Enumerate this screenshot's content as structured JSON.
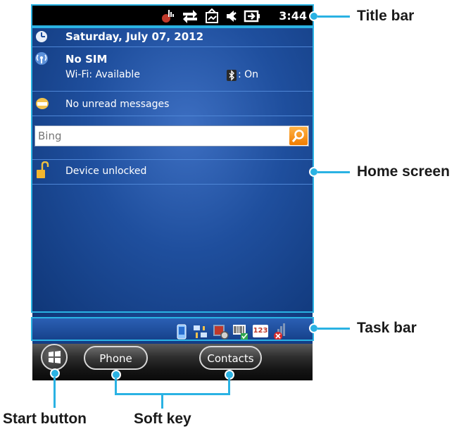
{
  "titlebar": {
    "clock": "3:44"
  },
  "home": {
    "date": "Saturday, July 07, 2012",
    "carrier": "No SIM",
    "wifi": "Wi-Fi: Available",
    "bluetooth": ": On",
    "messages": "No unread messages",
    "search_placeholder": "Bing",
    "lock_status": "Device unlocked"
  },
  "taskbar": {
    "badge_123": "123"
  },
  "softkeys": {
    "left": "Phone",
    "right": "Contacts"
  },
  "callouts": {
    "title_bar": "Title bar",
    "home_screen": "Home screen",
    "task_bar": "Task bar",
    "start_button": "Start button",
    "soft_key": "Soft key"
  },
  "colors": {
    "callout": "#2ab2e3",
    "bing_orange": "#f08a00",
    "home_blue": "#1f4f9e"
  },
  "icons": {
    "title_bar": [
      "signal-icon",
      "sync-icon",
      "network-icon",
      "volume-muted-icon",
      "battery-charging-icon"
    ],
    "home": [
      "clock-icon",
      "wireless-icon",
      "bluetooth-icon",
      "envelope-icon",
      "search-icon",
      "padlock-icon"
    ],
    "task_bar": [
      "device-icon",
      "connectivity-icon",
      "settings-icon",
      "barcode-icon",
      "input-123-icon",
      "network-error-icon"
    ],
    "soft_key_bar": [
      "windows-logo-icon"
    ]
  }
}
